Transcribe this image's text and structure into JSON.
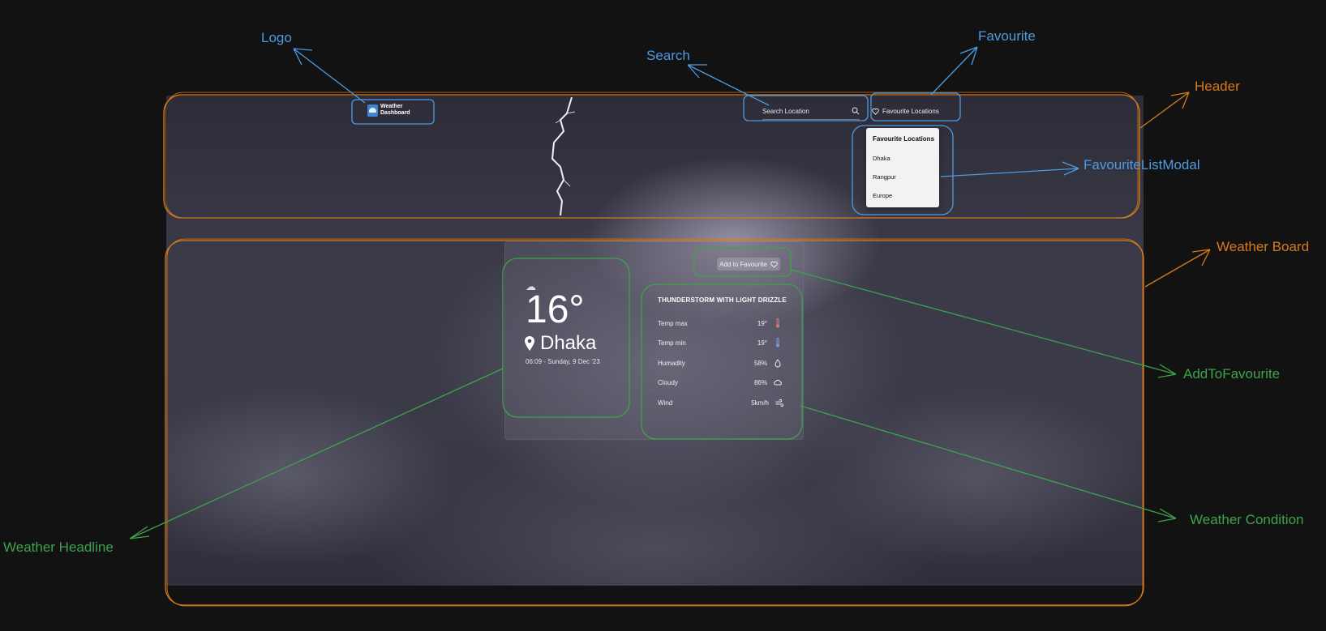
{
  "header": {
    "logo_text": "Weather\nDashboard",
    "search_placeholder": "Search Location",
    "favourite_button_label": "Favourite Locations"
  },
  "favourite_modal": {
    "title": "Favourite Locations",
    "items": [
      "Dhaka",
      "Rangpur",
      "Europe"
    ]
  },
  "weather": {
    "add_to_favourite_label": "Add to Favourite",
    "temperature": "16°",
    "location": "Dhaka",
    "datetime": "06:09 - Sunday, 9 Dec '23",
    "condition_title": "THUNDERSTORM WITH LIGHT DRIZZLE",
    "conditions": [
      {
        "label": "Temp max",
        "value": "19°",
        "icon": "thermometer-hot-icon"
      },
      {
        "label": "Temp min",
        "value": "19°",
        "icon": "thermometer-cold-icon"
      },
      {
        "label": "Humadity",
        "value": "58%",
        "icon": "droplet-icon"
      },
      {
        "label": "Cloudy",
        "value": "86%",
        "icon": "cloud-icon"
      },
      {
        "label": "Wind",
        "value": "5km/h",
        "icon": "wind-icon"
      }
    ]
  },
  "annotations": {
    "logo": "Logo",
    "search": "Search",
    "favourite": "Favourite",
    "header": "Header",
    "favourite_list_modal": "FavouriteListModal",
    "weather_board": "Weather Board",
    "add_to_favourite": "AddToFavourite",
    "weather_condition": "Weather Condition",
    "weather_headline": "Weather Headline"
  },
  "colors": {
    "background": "#121212",
    "annotation_blue": "#4d9be0",
    "annotation_orange": "#d87a1c",
    "annotation_green": "#3ea34c"
  }
}
